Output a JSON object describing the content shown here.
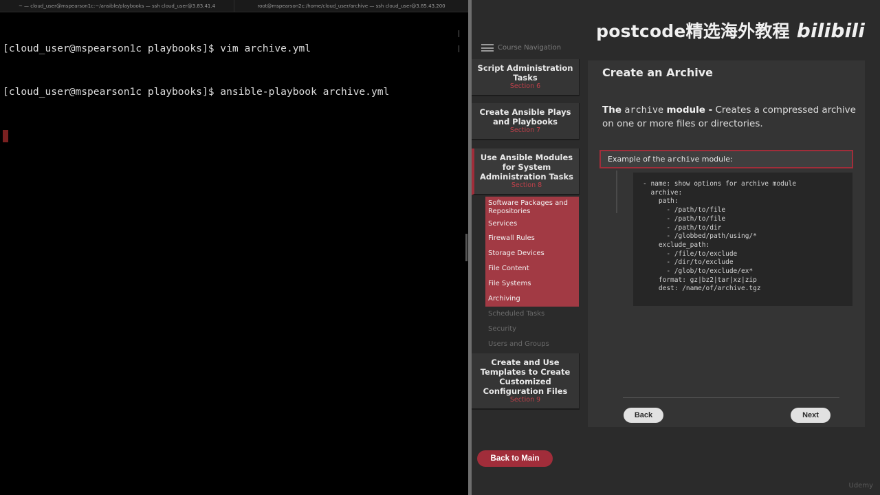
{
  "terminal": {
    "tabs": [
      "~ — cloud_user@mspearson1c:~/ansible/playbooks — ssh cloud_user@3.83.41.4",
      "root@mspearson2c:/home/cloud_user/archive — ssh cloud_user@3.85.43.200"
    ],
    "lines": [
      "[cloud_user@mspearson1c playbooks]$ vim archive.yml",
      "[cloud_user@mspearson1c playbooks]$ ansible-playbook archive.yml"
    ]
  },
  "brand": {
    "text": "postcode精选海外教程",
    "logo": "bilibili"
  },
  "nav": {
    "title": "Course Navigation",
    "sections": [
      {
        "title": "Script Administration Tasks",
        "sub": "Section 6"
      },
      {
        "title": "Create Ansible Plays and Playbooks",
        "sub": "Section 7"
      },
      {
        "title": "Use Ansible Modules for System Administration Tasks",
        "sub": "Section 8"
      },
      {
        "title": "Create and Use Templates to Create Customized Configuration Files",
        "sub": "Section 9"
      }
    ],
    "subitems": [
      {
        "label": "Software Packages and Repositories",
        "status": "done"
      },
      {
        "label": "Services",
        "status": "done"
      },
      {
        "label": "Firewall Rules",
        "status": "done"
      },
      {
        "label": "Storage Devices",
        "status": "done"
      },
      {
        "label": "File Content",
        "status": "done"
      },
      {
        "label": "File Systems",
        "status": "done"
      },
      {
        "label": "Archiving",
        "status": "done"
      },
      {
        "label": "Scheduled Tasks",
        "status": "pending"
      },
      {
        "label": "Security",
        "status": "pending"
      },
      {
        "label": "Users and Groups",
        "status": "pending"
      }
    ],
    "back_main": "Back to Main"
  },
  "content": {
    "title": "Create an Archive",
    "desc_the": "The",
    "desc_module_name": "archive",
    "desc_module": "module -",
    "desc_text": "Creates a compressed archive on one or more files or directories.",
    "example_prefix": "Example of the",
    "example_module": "archive",
    "example_suffix": "module:",
    "code_lines": [
      "- name: show options for archive module",
      "  archive:",
      "    path:",
      "      - /path/to/file",
      "      - /path/to/file",
      "      - /path/to/dir",
      "      - /globbed/path/using/*",
      "    exclude_path:",
      "      - /file/to/exclude",
      "      - /dir/to/exclude",
      "      - /glob/to/exclude/ex*",
      "    format: gz|bz2|tar|xz|zip",
      "    dest: /name/of/archive.tgz"
    ],
    "back": "Back",
    "next": "Next"
  },
  "watermark": "Udemy",
  "colors": {
    "accent": "#a12d3a",
    "panel": "#2b2b2b",
    "content": "#343434"
  }
}
